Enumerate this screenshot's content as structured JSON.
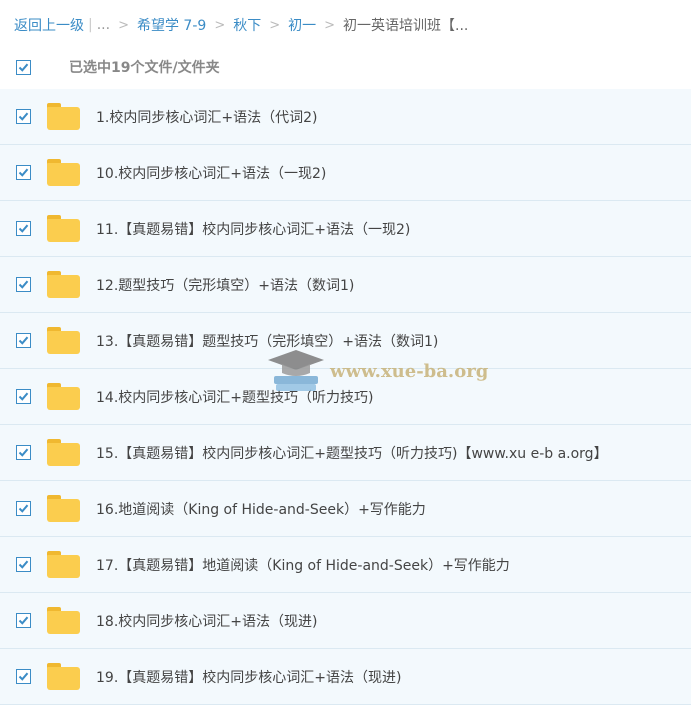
{
  "breadcrumb": {
    "back": "返回上一级",
    "ellipsis": "...",
    "items": [
      "希望学 7-9",
      "秋下",
      "初一"
    ],
    "current": "初一英语培训班【..."
  },
  "selection": {
    "label": "已选中19个文件/文件夹"
  },
  "files": [
    {
      "name": "1.校内同步核心词汇+语法（代词2)"
    },
    {
      "name": "10.校内同步核心词汇+语法（一现2)"
    },
    {
      "name": "11.【真题易错】校内同步核心词汇+语法（一现2)"
    },
    {
      "name": "12.题型技巧（完形填空）+语法（数词1)"
    },
    {
      "name": "13.【真题易错】题型技巧（完形填空）+语法（数词1)"
    },
    {
      "name": "14.校内同步核心词汇+题型技巧（听力技巧)"
    },
    {
      "name": "15.【真题易错】校内同步核心词汇+题型技巧（听力技巧)【www.xu e-b a.org】"
    },
    {
      "name": "16.地道阅读（King of Hide-and-Seek）+写作能力"
    },
    {
      "name": "17.【真题易错】地道阅读（King of Hide-and-Seek）+写作能力"
    },
    {
      "name": "18.校内同步核心词汇+语法（现进)"
    },
    {
      "name": "19.【真题易错】校内同步核心词汇+语法（现进)"
    }
  ],
  "watermark": {
    "text": "www.xue-ba.org"
  },
  "colors": {
    "accent": "#3b8cc6",
    "row_bg": "#f3f9fd",
    "folder": "#fbcd4e"
  },
  "icons": {
    "checkbox": "checkbox-checked-icon",
    "folder": "folder-icon",
    "watermark_logo": "graduation-cap-icon"
  }
}
